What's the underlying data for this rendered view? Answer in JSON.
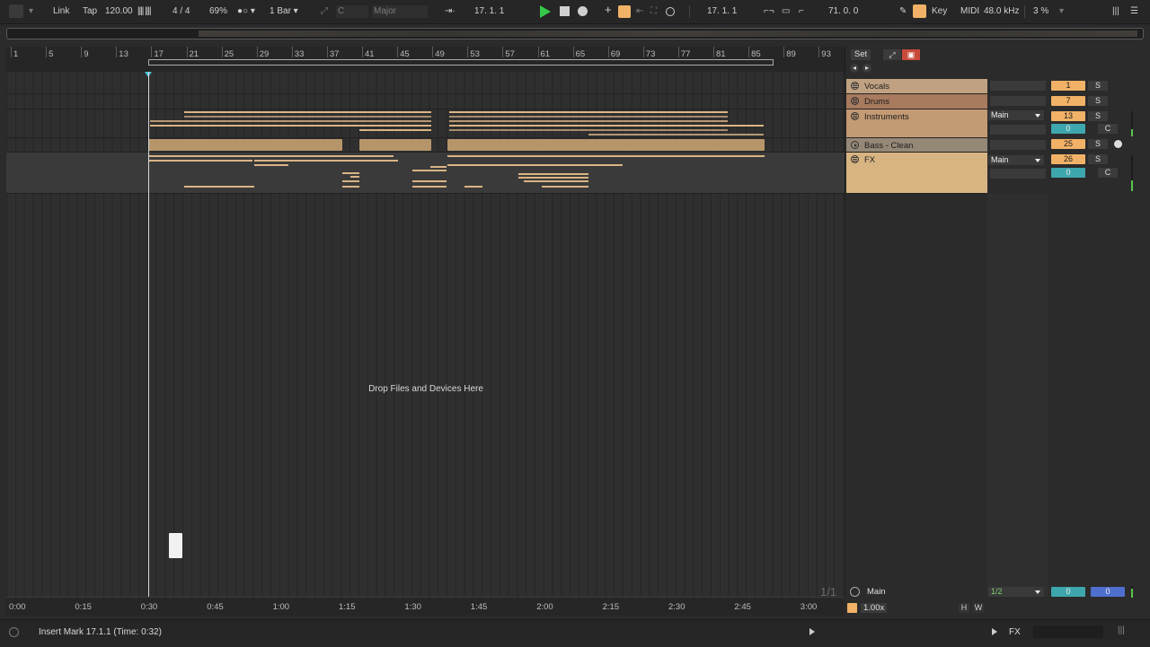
{
  "toolbar": {
    "link": "Link",
    "tap": "Tap",
    "tempo": "120.00",
    "time_signature": "4 / 4",
    "zoom": "69%",
    "quantize": "1 Bar",
    "key_root": "C",
    "key_scale": "Major",
    "arrangement_position": "17.   1.   1",
    "loop_start": "17.   1.   1",
    "loop_length": "71.   0.   0",
    "key_label": "Key",
    "midi_label": "MIDI",
    "sample_rate": "48.0 kHz",
    "cpu": "3 %"
  },
  "ruler": {
    "bars": [
      "1",
      "5",
      "9",
      "13",
      "17",
      "21",
      "25",
      "29",
      "33",
      "37",
      "41",
      "45",
      "49",
      "53",
      "57",
      "61",
      "65",
      "69",
      "73",
      "77",
      "81",
      "85",
      "89",
      "93"
    ]
  },
  "arrangement": {
    "drop_text": "Drop Files and Devices Here"
  },
  "time_ruler": {
    "labels": [
      "0:00",
      "0:15",
      "0:30",
      "0:45",
      "1:00",
      "1:15",
      "1:30",
      "1:45",
      "2:00",
      "2:15",
      "2:30",
      "2:45",
      "3:00"
    ]
  },
  "mixer": {
    "set_label": "Set",
    "tracks": [
      {
        "name": "Vocals",
        "number": "1",
        "solo": "S"
      },
      {
        "name": "Drums",
        "number": "7",
        "solo": "S"
      },
      {
        "name": "Instruments",
        "routing": "Main",
        "number": "13",
        "solo": "S",
        "send": "0",
        "cue": "C"
      },
      {
        "name": "Bass - Clean",
        "number": "25",
        "solo": "S"
      },
      {
        "name": "FX",
        "routing": "Main",
        "number": "26",
        "solo": "S",
        "send": "0",
        "cue": "C"
      }
    ],
    "master": {
      "page": "1/1",
      "name": "Main",
      "routing": "1/2",
      "value_a": "0",
      "value_b": "0",
      "tempo_factor": "1.00x",
      "h": "H",
      "w": "W"
    }
  },
  "status": {
    "message": "Insert Mark 17.1.1 (Time: 0:32)",
    "fx_label": "FX"
  },
  "colors": {
    "accent_orange": "#f1b267",
    "play_green": "#35c94a",
    "teal": "#3ea6ad",
    "clip_tan": "#b7956a"
  }
}
